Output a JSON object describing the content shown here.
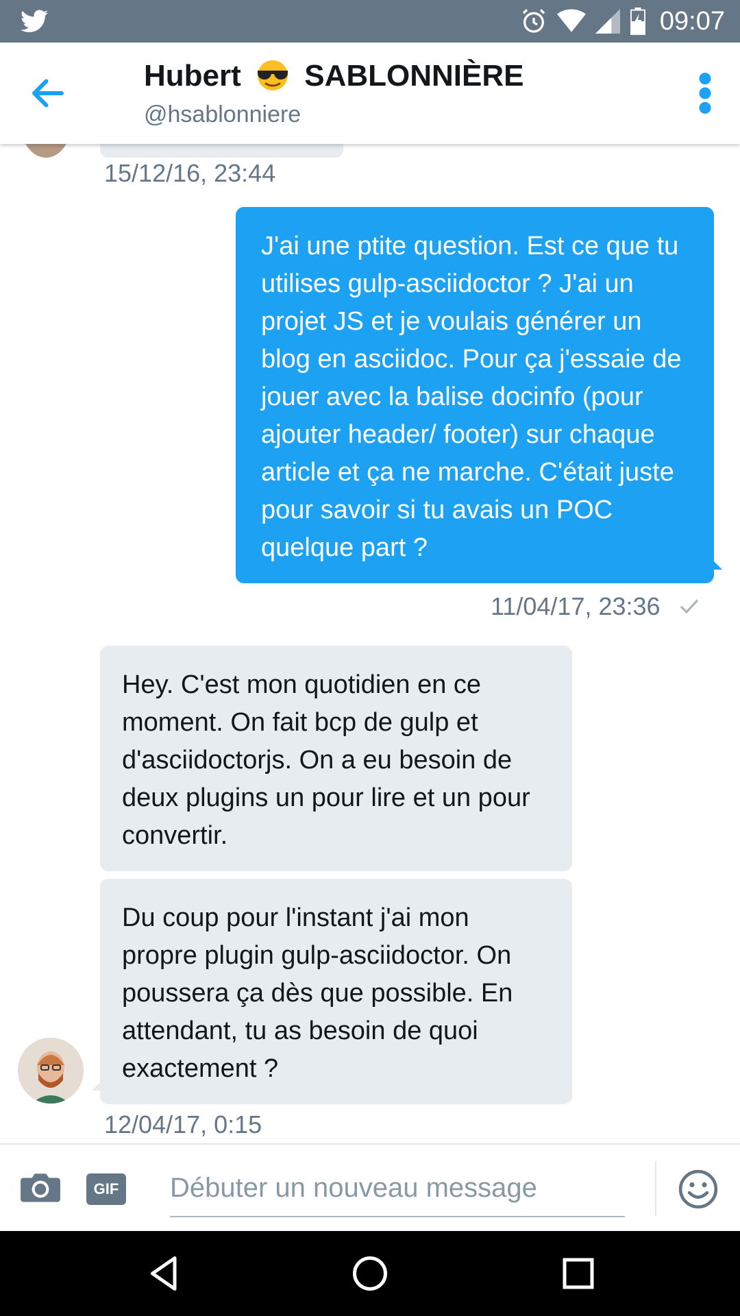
{
  "status_bar": {
    "time": "09:07"
  },
  "header": {
    "name_first": "Hubert",
    "name_emoji": "smiling-face-with-sunglasses",
    "name_last": "SABLONNIÈRE",
    "handle": "@hsablonniere"
  },
  "messages": {
    "prev_timestamp": "15/12/16, 23:44",
    "outgoing": {
      "text": "J'ai une ptite question. Est ce que tu utilises gulp-asciidoctor ? J'ai un projet JS et je voulais générer un blog en asciidoc. Pour ça j'essaie de jouer avec la balise docinfo (pour ajouter header/ footer) sur chaque article et ça ne marche. C'était juste pour savoir si tu avais un POC quelque part ?",
      "timestamp": "11/04/17, 23:36"
    },
    "incoming": [
      {
        "text": "Hey. C'est mon quotidien en ce moment. On fait bcp de gulp et d'asciidoctorjs. On a eu besoin de deux plugins un pour lire et un pour convertir."
      },
      {
        "text": "Du coup pour l'instant j'ai mon propre plugin gulp-asciidoctor. On poussera ça dès que possible. En attendant, tu as besoin de quoi exactement ?"
      }
    ],
    "incoming_timestamp": "12/04/17, 0:15"
  },
  "composer": {
    "placeholder": "Débuter un nouveau message",
    "gif_label": "GIF"
  },
  "colors": {
    "accent": "#1da1f2",
    "status_bar": "#657786",
    "incoming_bubble": "#e6ecf0"
  }
}
